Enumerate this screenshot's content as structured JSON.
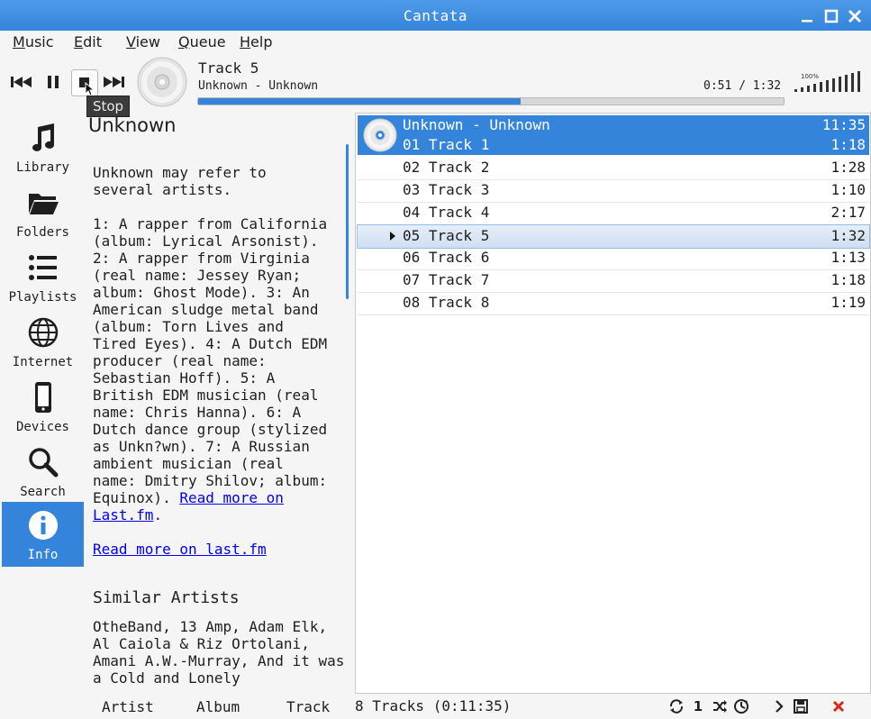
{
  "window": {
    "title": "Cantata"
  },
  "menu": [
    {
      "first": "M",
      "rest": "usic"
    },
    {
      "first": "E",
      "rest": "dit"
    },
    {
      "first": "V",
      "rest": "iew"
    },
    {
      "first": "Q",
      "rest": "ueue"
    },
    {
      "first": "H",
      "rest": "elp"
    }
  ],
  "toolbar": {
    "tooltip": "Stop"
  },
  "now_playing": {
    "title": "Track 5",
    "artist_album": "Unknown - Unknown",
    "time": "0:51 / 1:32",
    "progress": 0.55
  },
  "volume": {
    "label": "100%",
    "level": 1.0
  },
  "sidebar": [
    {
      "label": "Library",
      "icon": "music-note-icon"
    },
    {
      "label": "Folders",
      "icon": "folder-icon"
    },
    {
      "label": "Playlists",
      "icon": "list-icon"
    },
    {
      "label": "Internet",
      "icon": "globe-icon"
    },
    {
      "label": "Devices",
      "icon": "phone-icon"
    },
    {
      "label": "Search",
      "icon": "search-icon"
    },
    {
      "label": "Info",
      "icon": "info-icon"
    }
  ],
  "info": {
    "heading": "Unknown",
    "body": "Unknown may refer to\nseveral artists.\n\n1: A rapper from California\n(album: Lyrical Arsonist).\n2: A rapper from Virginia\n(real name: Jessey Ryan;\nalbum: Ghost Mode). 3: An\nAmerican sludge metal band\n(album: Torn Lives and\nTired Eyes). 4: A Dutch EDM\nproducer (real name:\nSebastian Hoff). 5: A\nBritish EDM musician (real\nname: Chris Hanna). 6: A\nDutch dance group (stylized\nas Unkn?wn). 7: A Russian\nambient musician (real\nname: Dmitry Shilov; album:\nEquinox). ",
    "inline_link": "Read more on\nLast.fm",
    "inline_link_after": ".",
    "lastfm_link": "Read more on last.fm",
    "similar_heading": "Similar Artists",
    "similar_body": "OtheBand, 13 Amp, Adam Elk, Al Caiola & Riz Ortolani, Amani A.W.-Murray, And it was a Cold and Lonely"
  },
  "queue": {
    "album": {
      "title": "Unknown - Unknown",
      "duration": "11:35"
    },
    "tracks": [
      {
        "label": "01 Track 1",
        "duration": "1:18"
      },
      {
        "label": "02 Track 2",
        "duration": "1:28"
      },
      {
        "label": "03 Track 3",
        "duration": "1:10"
      },
      {
        "label": "04 Track 4",
        "duration": "2:17"
      },
      {
        "label": "05 Track 5",
        "duration": "1:32"
      },
      {
        "label": "06 Track 6",
        "duration": "1:13"
      },
      {
        "label": "07 Track 7",
        "duration": "1:18"
      },
      {
        "label": "08 Track 8",
        "duration": "1:19"
      }
    ]
  },
  "statusbar": {
    "crumbs": [
      "Artist",
      "Album",
      "Track"
    ],
    "summary": "8 Tracks (0:11:35)",
    "single_label": "1"
  },
  "colors": {
    "accent": "#3584dc",
    "close_red": "#d9261c"
  }
}
